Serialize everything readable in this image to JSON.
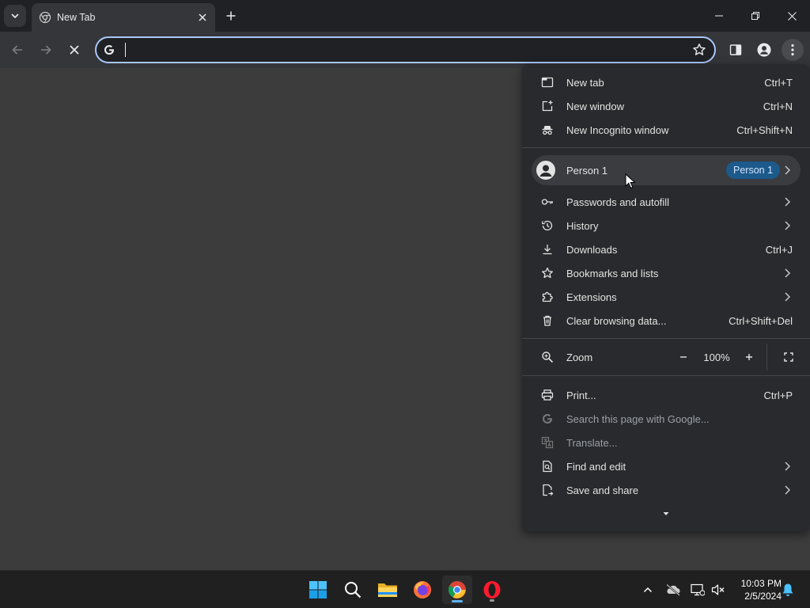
{
  "tab": {
    "title": "New Tab",
    "favicon": "chrome-newtab-icon"
  },
  "omnibox": {
    "value": "",
    "placeholder": ""
  },
  "menu": {
    "items_group1": [
      {
        "label": "New tab",
        "shortcut": "Ctrl+T",
        "icon": "new-tab-icon"
      },
      {
        "label": "New window",
        "shortcut": "Ctrl+N",
        "icon": "new-window-icon"
      },
      {
        "label": "New Incognito window",
        "shortcut": "Ctrl+Shift+N",
        "icon": "incognito-icon"
      }
    ],
    "profile": {
      "label": "Person 1",
      "badge": "Person 1"
    },
    "items_group2": [
      {
        "label": "Passwords and autofill",
        "shortcut": "",
        "icon": "key-icon",
        "submenu": true
      },
      {
        "label": "History",
        "shortcut": "",
        "icon": "history-icon",
        "submenu": true
      },
      {
        "label": "Downloads",
        "shortcut": "Ctrl+J",
        "icon": "download-icon"
      },
      {
        "label": "Bookmarks and lists",
        "shortcut": "",
        "icon": "star-icon",
        "submenu": true
      },
      {
        "label": "Extensions",
        "shortcut": "",
        "icon": "puzzle-icon",
        "submenu": true
      },
      {
        "label": "Clear browsing data...",
        "shortcut": "Ctrl+Shift+Del",
        "icon": "trash-icon"
      }
    ],
    "zoom": {
      "label": "Zoom",
      "value": "100%",
      "minus": "−",
      "plus": "+"
    },
    "items_group3": [
      {
        "label": "Print...",
        "shortcut": "Ctrl+P",
        "icon": "print-icon"
      },
      {
        "label": "Search this page with Google...",
        "shortcut": "",
        "icon": "google-icon",
        "disabled": true
      },
      {
        "label": "Translate...",
        "shortcut": "",
        "icon": "translate-icon",
        "disabled": true
      },
      {
        "label": "Find and edit",
        "shortcut": "",
        "icon": "find-icon",
        "submenu": true
      },
      {
        "label": "Save and share",
        "shortcut": "",
        "icon": "save-share-icon",
        "submenu": true
      }
    ]
  },
  "taskbar": {
    "clock_time": "10:03 PM",
    "clock_date": "2/5/2024"
  },
  "colors": {
    "accent": "#a8c7fa",
    "badge": "#1d5a8c",
    "menu_bg": "#292a2d",
    "page_bg": "#3c3c3c"
  }
}
